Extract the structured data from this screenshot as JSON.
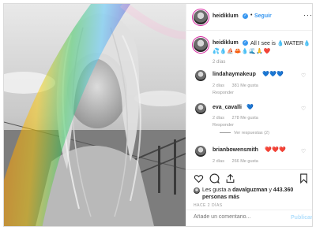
{
  "post": {
    "username": "heidiklum",
    "follow_label": "Seguir",
    "caption": {
      "text": "All I see is 💧WATER💧",
      "emojis": "💦💧⛵🦀💧🌊🙏❤️"
    },
    "caption_time": "2 días"
  },
  "comments": [
    {
      "username": "lindahaymakeup",
      "text": "💙💙💙",
      "time": "2 días",
      "likes": "381 Me gusta",
      "reply": "Responder"
    },
    {
      "username": "eva_cavalli",
      "text": "💙",
      "time": "2 días",
      "likes": "278 Me gusta",
      "reply": "Responder",
      "view_replies": "Ver respuestas (2)"
    },
    {
      "username": "brianbowensmith",
      "text": "❤️❤️❤️",
      "time": "2 días",
      "likes": "266 Me gusta",
      "reply": "Responder"
    }
  ],
  "likes": {
    "prefix": "Les gusta a",
    "user": "davalguzman",
    "connector": "y",
    "count": "443.360 personas más"
  },
  "date_label": "HACE 2 DÍAS",
  "comment_box": {
    "placeholder": "Añade un comentario...",
    "post_label": "Publicar"
  },
  "icons": {
    "like": "heart-icon",
    "comment": "comment-icon",
    "share": "share-icon",
    "save": "bookmark-icon",
    "more": "more-icon",
    "verified": "verified-badge-icon"
  },
  "colors": {
    "link_blue": "#3897f0",
    "text": "#262626",
    "muted": "#999999",
    "border": "#dbdbdb",
    "post_disabled": "#b2dffc"
  }
}
